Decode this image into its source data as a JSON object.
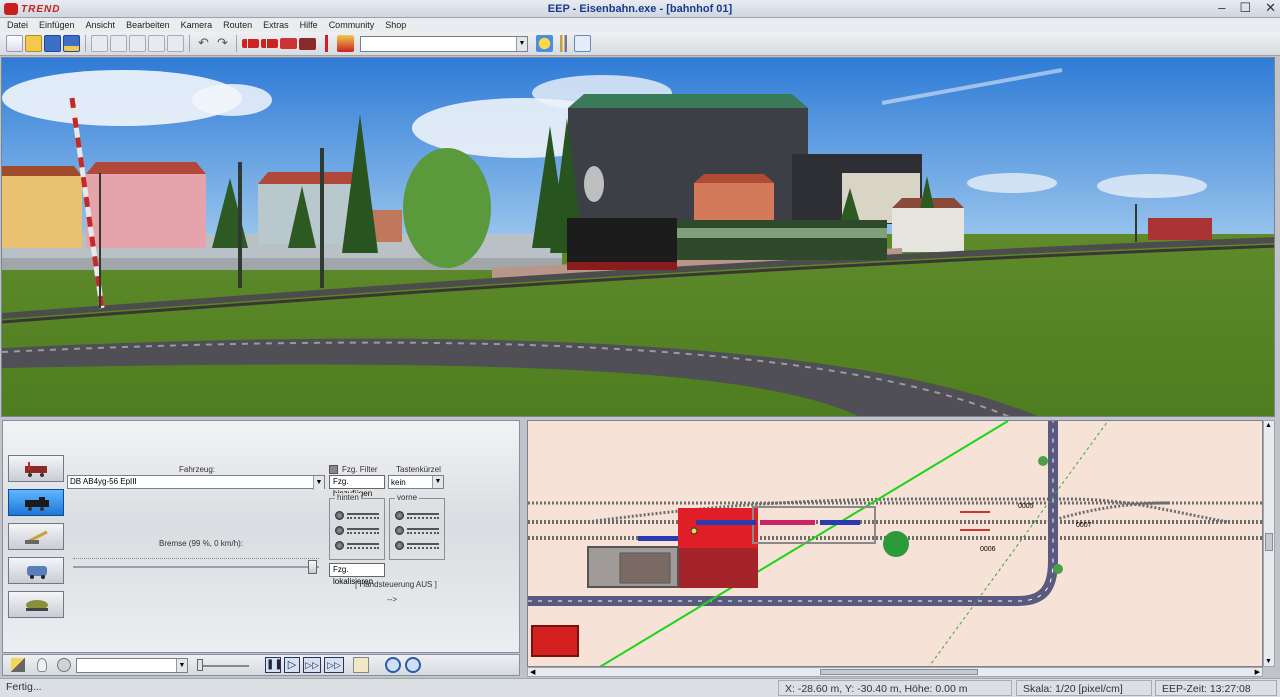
{
  "window": {
    "logo_text": "TREND",
    "title": "EEP - Eisenbahn.exe - [bahnhof 01]"
  },
  "menu": [
    "Datei",
    "Einfügen",
    "Ansicht",
    "Bearbeiten",
    "Kamera",
    "Routen",
    "Extras",
    "Hilfe",
    "Community",
    "Shop"
  ],
  "controls": {
    "fahrzeug_label": "Fahrzeug:",
    "fahrzeug_value": "DB AB4yg-56 EpIII",
    "fzg_filter_label": "Fzg. Filter",
    "tastenkuerzel_label": "Tastenkürzel",
    "tastenkuerzel_value": "kein",
    "fzg_hinzufuegen": "Fzg. hinzufügen",
    "hinten_label": "hinten",
    "vorne_label": "vorne",
    "bremse_label": "Bremse (99 %, 0 km/h):",
    "bremse_percent": 99,
    "fzg_lokalisieren": "Fzg. lokalisieren",
    "handsteuerung": "[ Handsteuerung AUS ]",
    "arrow": "-->"
  },
  "map": {
    "labels": [
      "0005",
      "0006",
      "0007"
    ]
  },
  "status": {
    "left": "Fertig...",
    "coords": "X: -28.60 m, Y: -30.40 m, Höhe: 0.00 m",
    "scale": "Skala: 1/20 [pixel/cm]",
    "time": "EEP-Zeit: 13:27:08"
  },
  "icons": {
    "toolbar": [
      "new-icon",
      "open-icon",
      "save-icon",
      "save-as-icon",
      "copy-icon",
      "paste-icon",
      "cut-icon",
      "duplicate-icon",
      "undo-icon",
      "redo-icon",
      "train-icon",
      "train-red-icon",
      "wagon-icon",
      "loco-icon",
      "signal-icon",
      "crane-icon",
      "weather-icon",
      "tools-icon",
      "settings-icon"
    ]
  }
}
